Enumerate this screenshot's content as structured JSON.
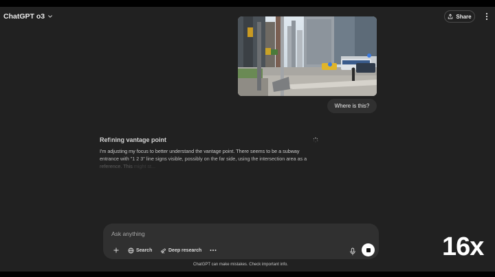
{
  "header": {
    "model_label": "ChatGPT o3",
    "share_label": "Share"
  },
  "conversation": {
    "user_message": "Where is this?",
    "thinking": {
      "title_prefix": "Ref",
      "title_fade": "i",
      "title_rest": "ning vantage point",
      "line1": "I'm adjusting my focus to better understand the vantage point. There seems to be a subway",
      "line2": "entrance with \"1 2 3\" line signs visible, possibly on the far side, using the intersection area as a",
      "line3a": "reference. This",
      "line3b": "might st..."
    }
  },
  "composer": {
    "placeholder": "Ask anything",
    "search_label": "Search",
    "deep_research_label": "Deep research"
  },
  "footer": {
    "disclaimer": "ChatGPT can make mistakes. Check important info."
  },
  "overlay": {
    "speed_badge": "16x"
  },
  "colors": {
    "background": "#212121",
    "surface": "#303030",
    "text": "#ececec"
  }
}
